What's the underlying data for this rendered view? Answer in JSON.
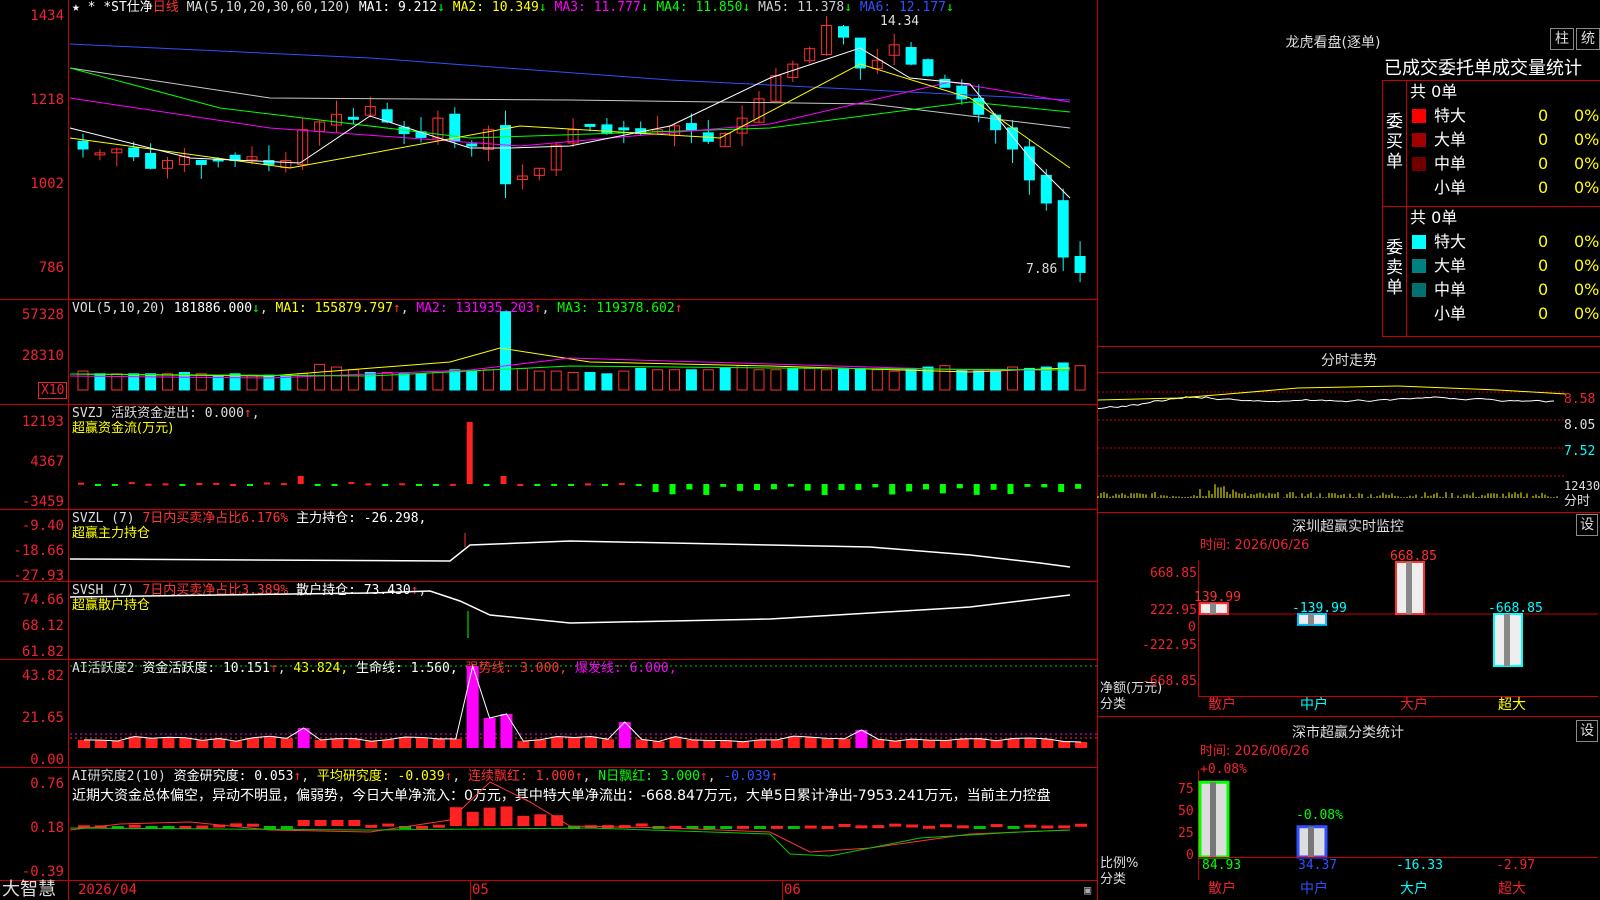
{
  "app": {
    "name": "大智慧"
  },
  "header": {
    "stars": "★ *",
    "stock_name": "*ST仕净",
    "period": "日线",
    "ma_label": "MA(5,10,20,30,60,120)",
    "ma_values": [
      {
        "name": "MA1",
        "value": "9.212",
        "arrow": "↓",
        "color": "#ffffff"
      },
      {
        "name": "MA2",
        "value": "10.349",
        "arrow": "↓",
        "color": "#ffff00"
      },
      {
        "name": "MA3",
        "value": "11.777",
        "arrow": "↓",
        "color": "#ff00ff"
      },
      {
        "name": "MA4",
        "value": "11.850",
        "arrow": "↓",
        "color": "#00ff00"
      },
      {
        "name": "MA5",
        "value": "11.378",
        "arrow": "↓",
        "color": "#c8c8c8"
      },
      {
        "name": "MA6",
        "value": "12.177",
        "arrow": "↓",
        "color": "#3050ff"
      }
    ],
    "high_mark": "14.34",
    "low_mark": "7.86"
  },
  "price_axis": [
    "1434",
    "1218",
    "1002",
    "786"
  ],
  "vol": {
    "label": "VOL(5,10,20)",
    "value": "181886.000",
    "ma1": "MA1: 155879.797",
    "ma2": "MA2: 131935.203",
    "ma3": "MA3: 119378.602",
    "axis": [
      "57328",
      "28310"
    ],
    "unit": "X10"
  },
  "svzj": {
    "label": "SVZJ 活跃资金进出: 0.000",
    "sub": "超赢资金流(万元)",
    "axis": [
      "12193",
      "4367",
      "-3459"
    ]
  },
  "svzl": {
    "label": "SVZL (7)",
    "red": "7日内买卖净占比6.176%",
    "hold": "主力持仓: -26.298,",
    "sub": "超赢主力持仓",
    "axis": [
      "-9.40",
      "-18.66",
      "-27.93"
    ]
  },
  "svsh": {
    "label": "SVSH (7)",
    "red": "7日内买卖净占比3.389%",
    "hold": "散户持仓: 73.430",
    "sub": "超赢散户持仓",
    "axis": [
      "74.66",
      "68.12",
      "61.82"
    ]
  },
  "ai1": {
    "label": "AI活跃度2",
    "v1": "资金活跃度: 10.151",
    "v2": "43.824,",
    "v3": "生命线: 1.560,",
    "v4": "强势线: 3.000,",
    "v5": "爆发线: 6.000,",
    "axis": [
      "43.82",
      "21.65",
      "0.00"
    ]
  },
  "ai2": {
    "label": "AI研究度2(10)",
    "v1": "资金研究度: 0.053",
    "v2": "平均研究度: -0.039",
    "v3": "连续飘红: 1.000",
    "v4": "N日飘红: 3.000",
    "v5": "-0.039",
    "comment": "近期大资金总体偏空，异动不明显，偏弱势，今日大单净流入：0万元，其中特大单净流出：-668.847万元，大单5日累计净出-7953.241万元，当前主力控盘",
    "axis": [
      "0.76",
      "0.18",
      "-0.39"
    ]
  },
  "dates": [
    "2026/04",
    "05",
    "06"
  ],
  "dragon": {
    "title": "龙虎看盘(逐单)",
    "btn1": "柱",
    "btn2": "统",
    "subtitle": "已成交委托单成交量统计",
    "buy_label": "委买单",
    "sell_label": "委卖单",
    "buy_total": "共 0单",
    "sell_total": "共 0单",
    "buy_rows": [
      {
        "name": "特大",
        "count": "0",
        "pct": "0%",
        "color": "#ff0000"
      },
      {
        "name": "大单",
        "count": "0",
        "pct": "0%",
        "color": "#a00000"
      },
      {
        "name": "中单",
        "count": "0",
        "pct": "0%",
        "color": "#700000"
      },
      {
        "name": "小单",
        "count": "0",
        "pct": "0%",
        "color": ""
      }
    ],
    "sell_rows": [
      {
        "name": "特大",
        "count": "0",
        "pct": "0%",
        "color": "#00ffff"
      },
      {
        "name": "大单",
        "count": "0",
        "pct": "0%",
        "color": "#008080"
      },
      {
        "name": "中单",
        "count": "0",
        "pct": "0%",
        "color": "#007070"
      },
      {
        "name": "小单",
        "count": "0",
        "pct": "0%",
        "color": ""
      }
    ]
  },
  "intraday": {
    "title": "分时走势",
    "axis": [
      "8.58",
      "8.05",
      "7.52"
    ],
    "vol_axis": "12430",
    "vol_label": "分时"
  },
  "monitor": {
    "title": "深圳超赢实时监控",
    "set": "设",
    "time": "时间: 2026/06/26",
    "axis": [
      "668.85",
      "222.95",
      "0",
      "-222.95",
      "-668.85"
    ],
    "ylabel": "净额(万元)",
    "xlabel": "分类",
    "cats": [
      "散户",
      "中户",
      "大户",
      "超大"
    ],
    "values": [
      "139.99",
      "-139.99",
      "668.85",
      "-668.85"
    ]
  },
  "classify": {
    "title": "深市超赢分类统计",
    "set": "设",
    "time": "时间: 2026/06/26",
    "axis": [
      "75",
      "50",
      "25",
      "0"
    ],
    "ylabel": "比例%",
    "xlabel": "分类",
    "cats": [
      "散户",
      "中户",
      "大户",
      "超大"
    ],
    "top_labels": [
      "+0.08%",
      "-0.08%"
    ],
    "bottom_values": [
      "84.93",
      "34.37",
      "-16.33",
      "-2.97"
    ]
  },
  "chart_data": [
    {
      "type": "bar",
      "title": "深圳超赢实时监控",
      "xlabel": "分类",
      "ylabel": "净额(万元)",
      "categories": [
        "散户",
        "中户",
        "大户",
        "超大"
      ],
      "values": [
        139.99,
        -139.99,
        668.85,
        -668.85
      ],
      "ylim": [
        -668.85,
        668.85
      ]
    },
    {
      "type": "bar",
      "title": "深市超赢分类统计",
      "xlabel": "分类",
      "ylabel": "比例%",
      "categories": [
        "散户",
        "中户",
        "大户",
        "超大"
      ],
      "values": [
        84.93,
        34.37,
        -16.33,
        -2.97
      ],
      "ylim": [
        0,
        75
      ]
    }
  ]
}
